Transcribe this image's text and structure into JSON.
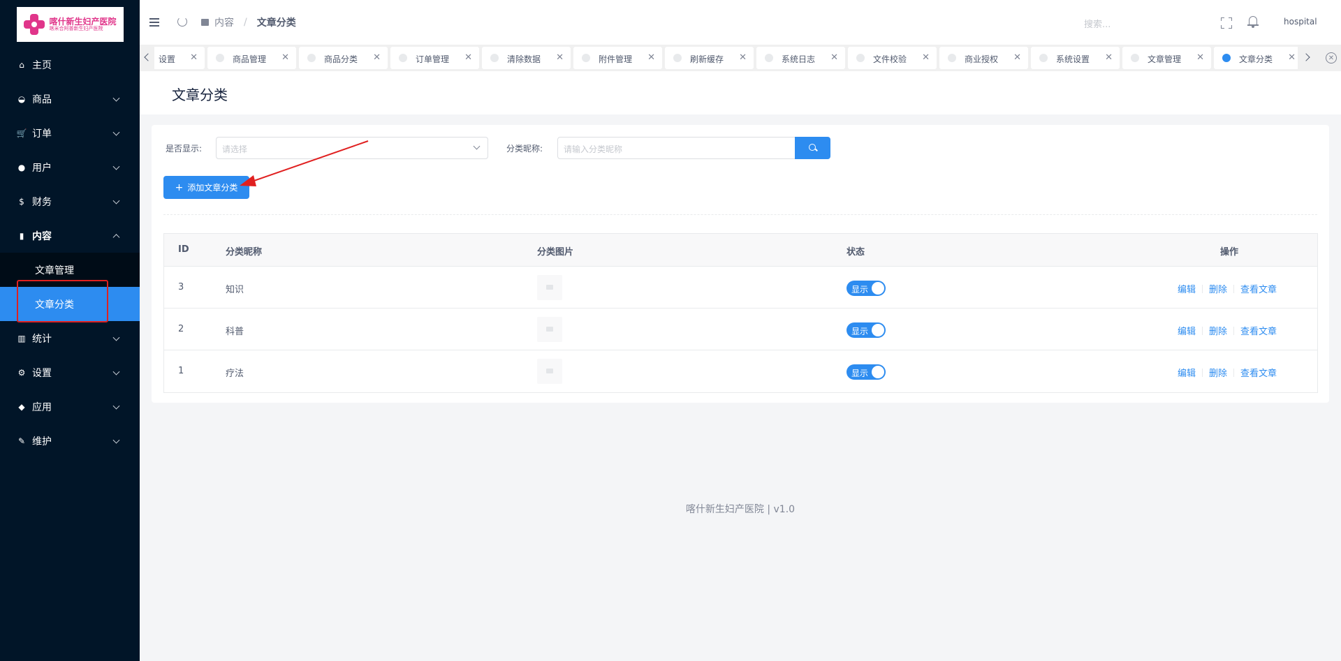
{
  "logo": {
    "line1": "喀什新生妇产医院",
    "line2": "喀米合阿普新生妇产医院"
  },
  "sidebar": {
    "items": [
      {
        "label": "主页",
        "icon": "home-icon",
        "glyph": "⌂"
      },
      {
        "label": "商品",
        "icon": "basket-icon",
        "glyph": "◒"
      },
      {
        "label": "订单",
        "icon": "cart-icon",
        "glyph": "🛒"
      },
      {
        "label": "用户",
        "icon": "user-icon",
        "glyph": "●"
      },
      {
        "label": "财务",
        "icon": "dollar-icon",
        "glyph": "$"
      },
      {
        "label": "内容",
        "icon": "book-icon",
        "glyph": "▮"
      },
      {
        "label": "统计",
        "icon": "chart-icon",
        "glyph": "▥"
      },
      {
        "label": "设置",
        "icon": "gear-icon",
        "glyph": "⚙"
      },
      {
        "label": "应用",
        "icon": "cube-icon",
        "glyph": "◆"
      },
      {
        "label": "维护",
        "icon": "wrench-icon",
        "glyph": "✎"
      }
    ],
    "submenu": [
      "文章管理",
      "文章分类"
    ]
  },
  "header": {
    "breadcrumb": [
      "内容",
      "文章分类"
    ],
    "breadcrumb_sep": "/",
    "search_placeholder": "搜索...",
    "username": "hospital"
  },
  "tabs": [
    {
      "label": "设置",
      "active": false
    },
    {
      "label": "商品管理",
      "active": false
    },
    {
      "label": "商品分类",
      "active": false
    },
    {
      "label": "订单管理",
      "active": false
    },
    {
      "label": "清除数据",
      "active": false
    },
    {
      "label": "附件管理",
      "active": false
    },
    {
      "label": "刷新缓存",
      "active": false
    },
    {
      "label": "系统日志",
      "active": false
    },
    {
      "label": "文件校验",
      "active": false
    },
    {
      "label": "商业授权",
      "active": false
    },
    {
      "label": "系统设置",
      "active": false
    },
    {
      "label": "文章管理",
      "active": false
    },
    {
      "label": "文章分类",
      "active": true
    }
  ],
  "page": {
    "title": "文章分类"
  },
  "filters": {
    "show_label": "是否显示:",
    "show_placeholder": "请选择",
    "name_label": "分类昵称:",
    "name_placeholder": "请输入分类昵称"
  },
  "add_button": "添加文章分类",
  "table": {
    "columns": [
      "ID",
      "分类昵称",
      "分类图片",
      "状态",
      "操作"
    ],
    "rows": [
      {
        "id": "3",
        "name": "知识",
        "status": "显示"
      },
      {
        "id": "2",
        "name": "科普",
        "status": "显示"
      },
      {
        "id": "1",
        "name": "疗法",
        "status": "显示"
      }
    ],
    "actions": [
      "编辑",
      "删除",
      "查看文章"
    ]
  },
  "footer": "喀什新生妇产医院 | v1.0",
  "colors": {
    "primary": "#2d8cf0",
    "sidebar": "#011528",
    "annotation": "#e02020"
  }
}
